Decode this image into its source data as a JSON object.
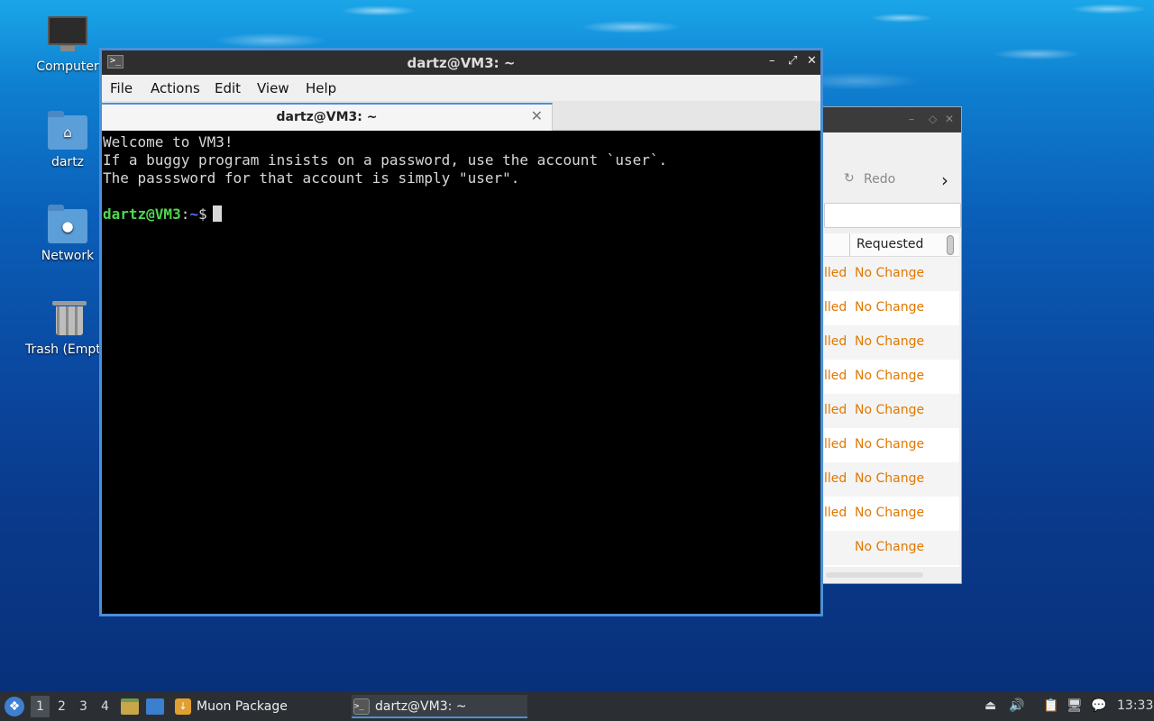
{
  "desktop": {
    "icons": [
      {
        "label": "Computer"
      },
      {
        "label": "dartz"
      },
      {
        "label": "Network"
      },
      {
        "label": "Trash (Empt"
      }
    ]
  },
  "background_window": {
    "redo_label": "Redo",
    "table": {
      "header": "Requested",
      "rows": [
        {
          "left": "lled",
          "requested": "No Change"
        },
        {
          "left": "lled",
          "requested": "No Change"
        },
        {
          "left": "lled",
          "requested": "No Change"
        },
        {
          "left": "lled",
          "requested": "No Change"
        },
        {
          "left": "lled",
          "requested": "No Change"
        },
        {
          "left": "lled",
          "requested": "No Change"
        },
        {
          "left": "lled",
          "requested": "No Change"
        },
        {
          "left": "lled",
          "requested": "No Change"
        },
        {
          "left": "",
          "requested": "No Change"
        }
      ]
    },
    "status_color": "#e07800"
  },
  "terminal": {
    "title": "dartz@VM3: ~",
    "menu": [
      "File",
      "Actions",
      "Edit",
      "View",
      "Help"
    ],
    "tab_label": "dartz@VM3: ~",
    "lines": [
      "Welcome to VM3!",
      "If a buggy program insists on a password, use the account `user`.",
      "The passsword for that account is simply \"user\"."
    ],
    "prompt_user": "dartz@VM3",
    "prompt_sep": ":",
    "prompt_path": "~",
    "prompt_symbol": "$",
    "accent_color": "#4a90d9"
  },
  "taskbar": {
    "workspaces": [
      "1",
      "2",
      "3",
      "4"
    ],
    "active_workspace": "1",
    "tasks": [
      {
        "label": "Muon Package Manager",
        "icon": "muon-icon"
      },
      {
        "label": "dartz@VM3: ~",
        "icon": "terminal-icon"
      }
    ],
    "clock": "13:33"
  }
}
